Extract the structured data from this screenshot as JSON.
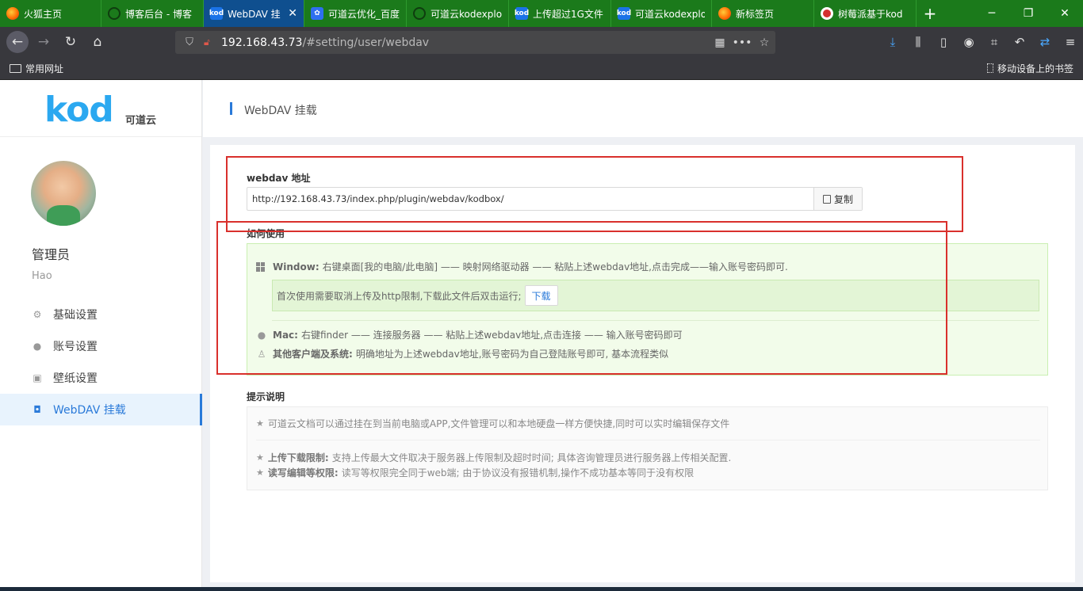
{
  "browser": {
    "tabs": [
      {
        "title": "火狐主页",
        "icon": "firefox-icon"
      },
      {
        "title": "博客后台 - 博客",
        "icon": "wordpress-icon"
      },
      {
        "title": "WebDAV 挂",
        "icon": "kod-icon",
        "active": true
      },
      {
        "title": "可道云优化_百度",
        "icon": "baidu-icon"
      },
      {
        "title": "可道云kodexplo",
        "icon": "wordpress-icon"
      },
      {
        "title": "上传超过1G文件",
        "icon": "kod-icon"
      },
      {
        "title": "可道云kodexplo",
        "icon": "kod-icon"
      },
      {
        "title": "新标签页",
        "icon": "firefox-icon"
      },
      {
        "title": "树莓派基于kod",
        "icon": "raspberry-icon"
      }
    ],
    "url_host": "192.168.43.73",
    "url_path": "/#setting/user/webdav",
    "bookmarks_left": "常用网址",
    "bookmarks_right": "移动设备上的书签"
  },
  "sidebar": {
    "logo": "kod",
    "logo_sub": "可道云",
    "user_name": "管理员",
    "user_sub": "Hao",
    "menu": [
      {
        "label": "基础设置",
        "icon": "gears-icon"
      },
      {
        "label": "账号设置",
        "icon": "user-icon"
      },
      {
        "label": "壁纸设置",
        "icon": "image-icon"
      },
      {
        "label": "WebDAV 挂载",
        "icon": "webdav-icon",
        "active": true
      }
    ]
  },
  "header": {
    "title": "WebDAV 挂载"
  },
  "webdav": {
    "address_label": "webdav 地址",
    "address_value": "http://192.168.43.73/index.php/plugin/webdav/kodbox/",
    "copy_label": "复制"
  },
  "howto": {
    "title": "如何使用",
    "window_label": "Window:",
    "window_text": "右键桌面[我的电脑/此电脑] —— 映射网络驱动器 —— 粘贴上述webdav地址,点击完成——输入账号密码即可.",
    "download_note": "首次使用需要取消上传及http限制,下载此文件后双击运行;",
    "download_label": "下载",
    "mac_label": "Mac:",
    "mac_text": "右键finder —— 连接服务器 —— 粘贴上述webdav地址,点击连接 —— 输入账号密码即可",
    "other_label": "其他客户端及系统:",
    "other_text": "明确地址为上述webdav地址,账号密码为自己登陆账号即可, 基本流程类似"
  },
  "tips": {
    "title": "提示说明",
    "line1": "可道云文档可以通过挂在到当前电脑或APP,文件管理可以和本地硬盘一样方便快捷,同时可以实时编辑保存文件",
    "line2_label": "上传下载限制:",
    "line2_text": "支持上传最大文件取决于服务器上传限制及超时时间; 具体咨询管理员进行服务器上传相关配置.",
    "line3_label": "读写编辑等权限:",
    "line3_text": "读写等权限完全同于web端; 由于协议没有报错机制,操作不成功基本等同于没有权限"
  },
  "colors": {
    "accent": "#2a7ad9",
    "tabbar": "#1b7a1b",
    "highlight_box": "#d9302c"
  }
}
